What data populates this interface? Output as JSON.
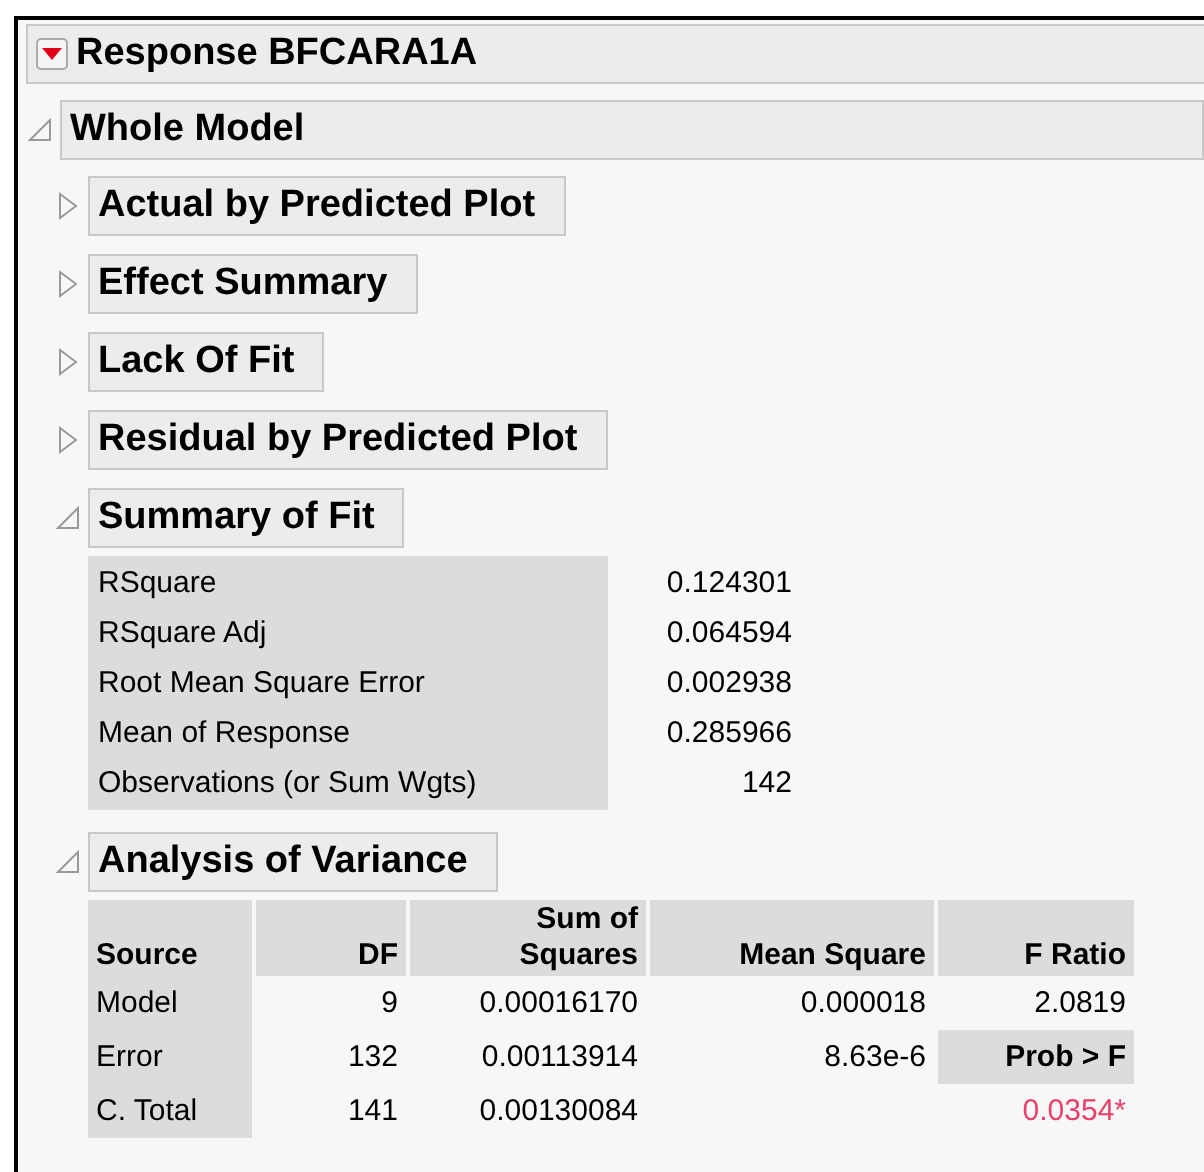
{
  "report": {
    "title": "Response BFCARA1A",
    "expanded": true,
    "sections": [
      {
        "title": "Whole Model",
        "expanded": true,
        "children": [
          {
            "kind": "section",
            "title": "Actual by Predicted Plot",
            "expanded": false
          },
          {
            "kind": "section",
            "title": "Effect Summary",
            "expanded": false
          },
          {
            "kind": "section",
            "title": "Lack Of Fit",
            "expanded": false
          },
          {
            "kind": "section",
            "title": "Residual by Predicted Plot",
            "expanded": false
          },
          {
            "kind": "summary",
            "title": "Summary of Fit",
            "expanded": true,
            "rows": [
              {
                "label": "RSquare",
                "value": "0.124301"
              },
              {
                "label": "RSquare Adj",
                "value": "0.064594"
              },
              {
                "label": "Root Mean Square Error",
                "value": "0.002938"
              },
              {
                "label": "Mean of Response",
                "value": "0.285966"
              },
              {
                "label": "Observations (or Sum Wgts)",
                "value": "142"
              }
            ]
          },
          {
            "kind": "anova",
            "title": "Analysis of Variance",
            "expanded": true,
            "columns": [
              "Source",
              "DF",
              "Sum of Squares",
              "Mean Square",
              "F Ratio"
            ],
            "rows": [
              {
                "cells": [
                  "Model",
                  "9",
                  "0.00016170",
                  "0.000018",
                  "2.0819"
                ],
                "kind": "value"
              },
              {
                "cells": [
                  "Error",
                  "132",
                  "0.00113914",
                  "8.63e-6",
                  "Prob > F"
                ],
                "kind": "subheader"
              },
              {
                "cells": [
                  "C. Total",
                  "141",
                  "0.00130084",
                  "",
                  "0.0354*"
                ],
                "kind": "pvalue",
                "significant": true
              }
            ]
          }
        ]
      }
    ]
  }
}
